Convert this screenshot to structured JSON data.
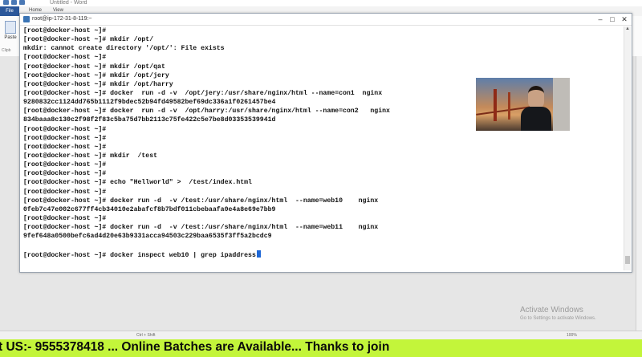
{
  "app": {
    "title": "Untitled - Word",
    "tabs": [
      "File",
      "Home",
      "View"
    ],
    "paste_label": "Paste",
    "clipboard_label": "Clipb",
    "status_left": "Ctrl + Shift",
    "zoom": "100%"
  },
  "watermark": {
    "line1": "Activate Windows",
    "line2": "Go to Settings to activate Windows."
  },
  "terminal": {
    "title": "root@ip-172-31-8-119:~",
    "lines": [
      "[root@docker-host ~]#",
      "[root@docker-host ~]# mkdir /opt/",
      "mkdir: cannot create directory '/opt/': File exists",
      "[root@docker-host ~]#",
      "[root@docker-host ~]# mkdir /opt/qat",
      "[root@docker-host ~]# mkdir /opt/jery",
      "[root@docker-host ~]# mkdir /opt/harry",
      "[root@docker-host ~]# docker  run -d -v  /opt/jery:/usr/share/nginx/html --name=con1  nginx",
      "9280832cc1124dd765b1112f9bdec52b94fd49582bef69dc336a1f0261457be4",
      "[root@docker-host ~]# docker  run -d -v  /opt/harry:/usr/share/nginx/html --name=con2   nginx",
      "834baaa8c130c2f98f2f83c5ba75d7bb2113c75fe422c5e7be8d03353539941d",
      "[root@docker-host ~]#",
      "[root@docker-host ~]#",
      "[root@docker-host ~]#",
      "[root@docker-host ~]# mkdir  /test",
      "[root@docker-host ~]#",
      "[root@docker-host ~]#",
      "[root@docker-host ~]# echo \"Hellworld\" >  /test/index.html",
      "[root@docker-host ~]#",
      "[root@docker-host ~]# docker run -d  -v /test:/usr/share/nginx/html  --name=web10    nginx",
      "0feb7c47e002c677ff4cb34010e2abafcf8b7bdf011cbebaafa0e4a8e69e7bb9",
      "[root@docker-host ~]#",
      "[root@docker-host ~]# docker run -d  -v /test:/usr/share/nginx/html  --name=web11    nginx",
      "9fef648a0500befc6ad4d20e63b9331acca94503c229baa6535f3ff5a2bcdc9",
      "",
      "[root@docker-host ~]# docker inspect web10 | grep ipaddress"
    ]
  },
  "banner": {
    "text": "t US:- 9555378418 ... Online Batches are Available... Thanks to join"
  }
}
